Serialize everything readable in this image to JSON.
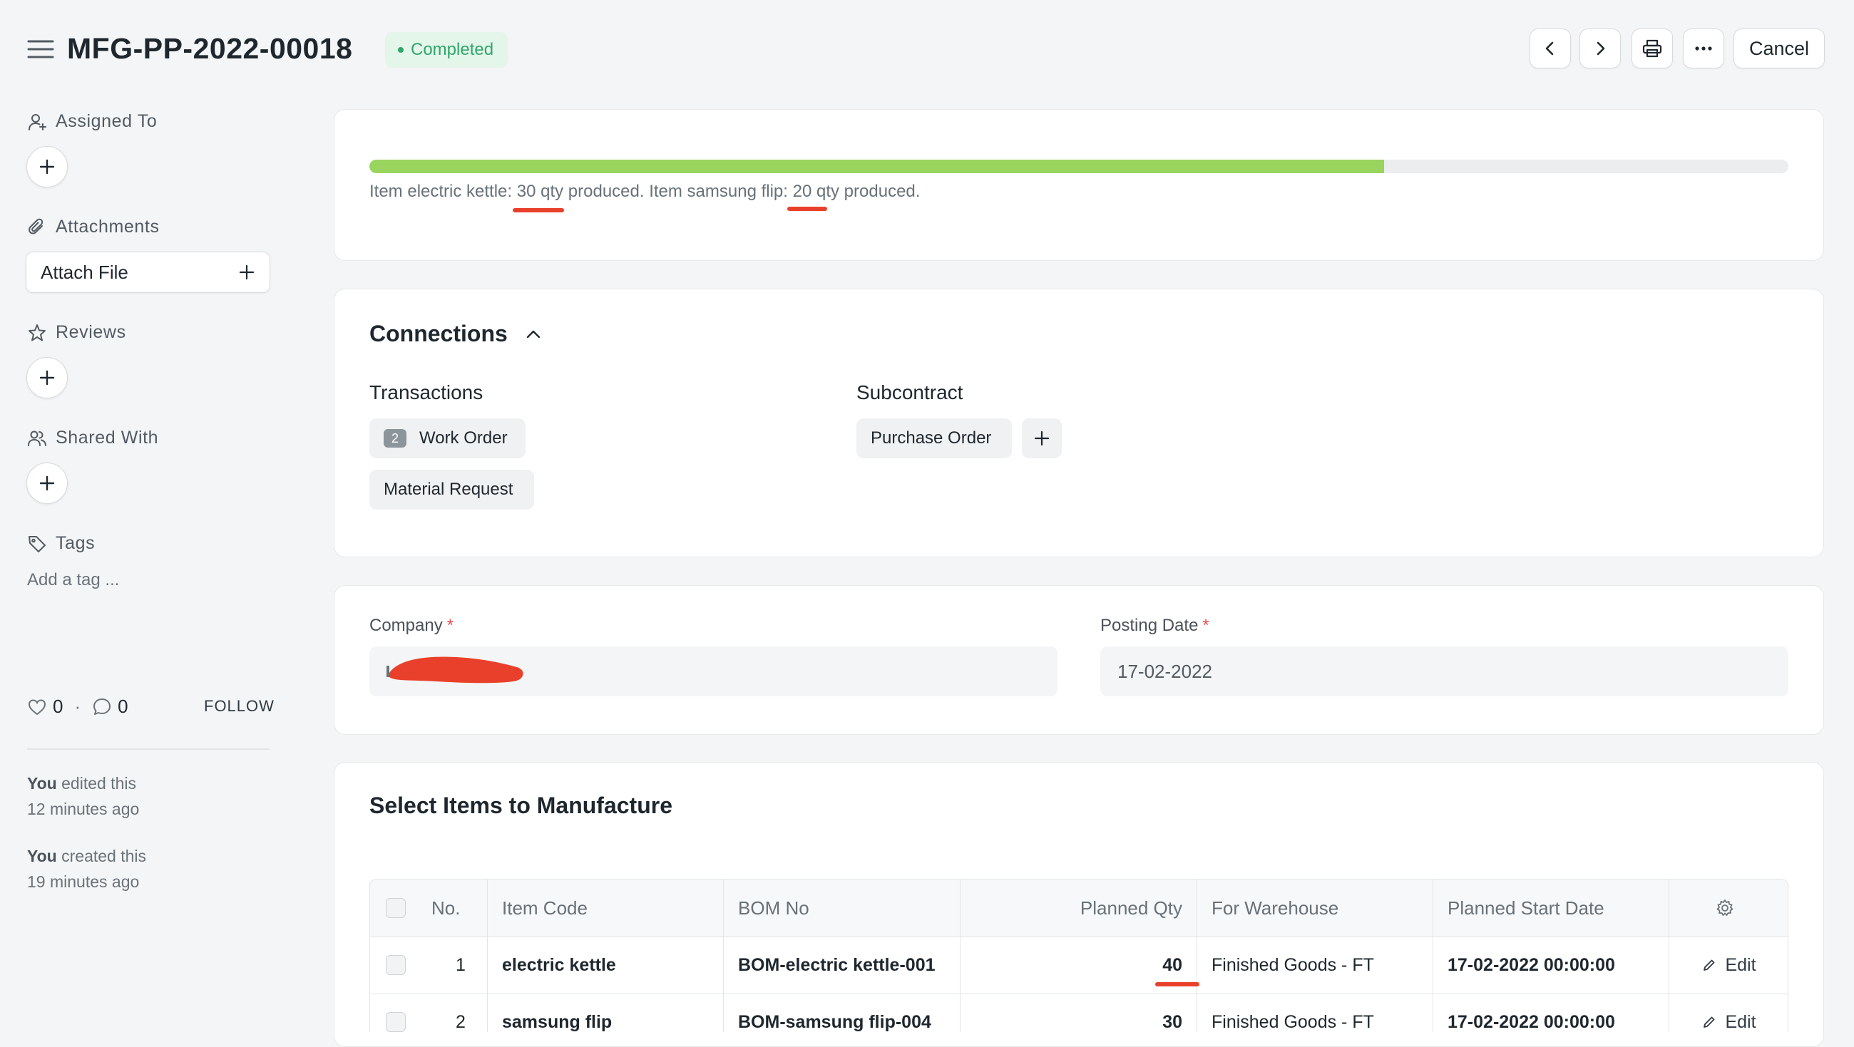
{
  "header": {
    "title": "MFG-PP-2022-00018",
    "status": "Completed",
    "cancel_label": "Cancel"
  },
  "sidebar": {
    "assigned_to": "Assigned To",
    "attachments": "Attachments",
    "attach_file": "Attach File",
    "reviews": "Reviews",
    "shared_with": "Shared With",
    "tags": "Tags",
    "add_tag": "Add a tag ...",
    "likes": "0",
    "comments": "0",
    "separator": "·",
    "follow": "FOLLOW",
    "activity": [
      {
        "who": "You",
        "action": " edited this",
        "when": "12 minutes ago"
      },
      {
        "who": "You",
        "action": " created this",
        "when": "19 minutes ago"
      }
    ]
  },
  "progress": {
    "percent": 71.5,
    "text_parts": [
      "Item electric kettle: ",
      "30",
      " qty produced. Item samsung flip: ",
      "20",
      " qty produced."
    ]
  },
  "connections": {
    "title": "Connections",
    "groups": [
      {
        "title": "Transactions",
        "items": [
          {
            "label": "Work Order",
            "count": "2"
          },
          {
            "label": "Material Request"
          }
        ]
      },
      {
        "title": "Subcontract",
        "items": [
          {
            "label": "Purchase Order"
          }
        ]
      }
    ]
  },
  "form": {
    "company_label": "Company",
    "company_value": "",
    "posting_date_label": "Posting Date",
    "posting_date_value": "17-02-2022"
  },
  "items": {
    "title": "Select Items to Manufacture",
    "columns": [
      "No.",
      "Item Code",
      "BOM No",
      "Planned Qty",
      "For Warehouse",
      "Planned Start Date"
    ],
    "rows": [
      {
        "no": "1",
        "item_code": "electric kettle",
        "bom_no": "BOM-electric kettle-001",
        "planned_qty": "40",
        "warehouse": "Finished Goods - FT",
        "start_date": "17-02-2022 00:00:00",
        "edit": "Edit"
      },
      {
        "no": "2",
        "item_code": "samsung flip",
        "bom_no": "BOM-samsung flip-004",
        "planned_qty": "30",
        "warehouse": "Finished Goods - FT",
        "start_date": "17-02-2022 00:00:00",
        "edit": "Edit"
      }
    ]
  },
  "colors": {
    "accent_green": "#98d45e",
    "status_green": "#30a66d",
    "annotation_red": "#e8402a"
  },
  "icons": [
    "menu-icon",
    "chevron-left-icon",
    "chevron-right-icon",
    "printer-icon",
    "more-icon",
    "user-plus-icon",
    "paperclip-icon",
    "star-icon",
    "users-icon",
    "tag-icon",
    "plus-icon",
    "heart-icon",
    "comment-icon",
    "chevron-up-icon",
    "gear-icon",
    "pencil-icon"
  ]
}
